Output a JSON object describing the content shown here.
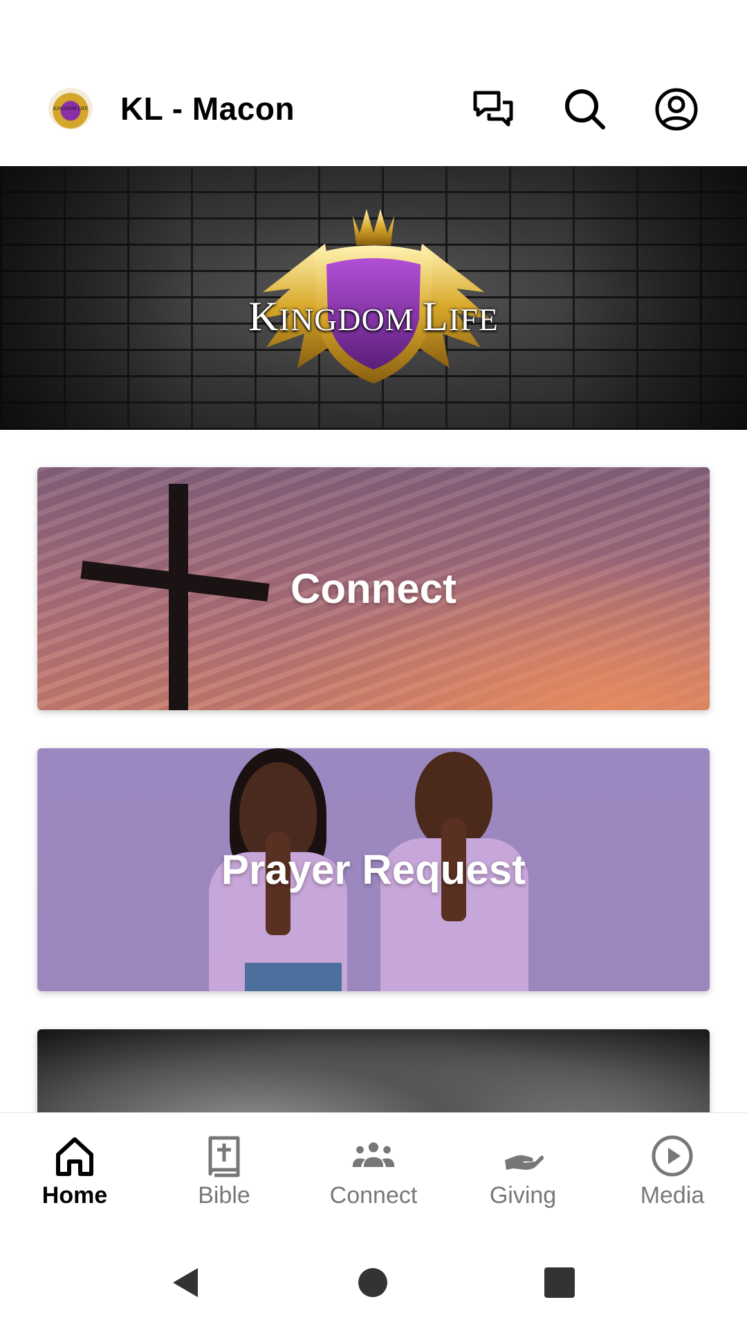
{
  "header": {
    "app_title": "KL - Macon",
    "logo_text": "KINGDOM LIFE",
    "icons": [
      "chat-icon",
      "search-icon",
      "account-icon"
    ]
  },
  "banner": {
    "title_first_k": "K",
    "title_rest_1": "INGDOM ",
    "title_l": "L",
    "title_rest_2": "IFE"
  },
  "cards": [
    {
      "label": "Connect"
    },
    {
      "label": "Prayer Request"
    },
    {
      "label": ""
    }
  ],
  "bottom_nav": {
    "items": [
      {
        "label": "Home",
        "icon": "home-icon",
        "active": true
      },
      {
        "label": "Bible",
        "icon": "bible-icon",
        "active": false
      },
      {
        "label": "Connect",
        "icon": "people-icon",
        "active": false
      },
      {
        "label": "Giving",
        "icon": "giving-hand-icon",
        "active": false
      },
      {
        "label": "Media",
        "icon": "play-circle-icon",
        "active": false
      }
    ]
  },
  "colors": {
    "active_nav": "#000000",
    "inactive_nav": "#777777",
    "prayer_card_bg": "#9c88c0",
    "crest_purple": "#8b2fa8",
    "crest_gold": "#d4a62a"
  }
}
